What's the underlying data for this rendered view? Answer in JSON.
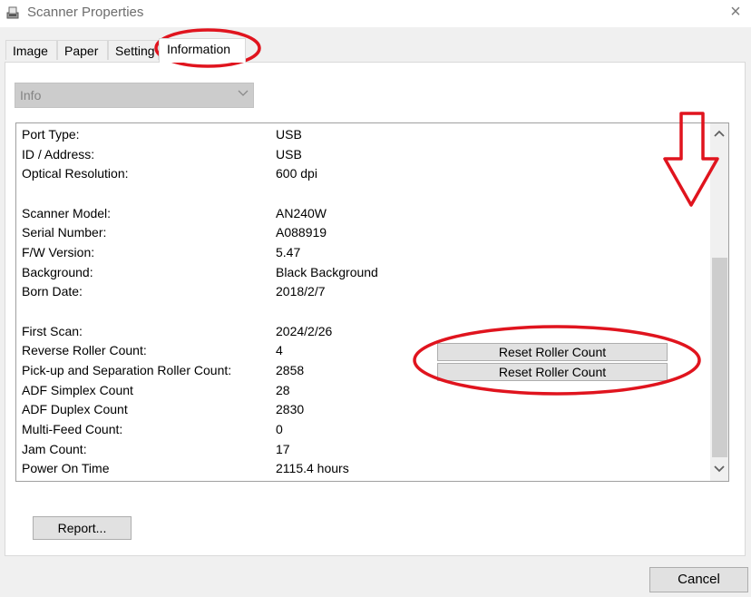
{
  "window": {
    "title": "Scanner Properties",
    "close_glyph": "×",
    "icon": "scanner-icon"
  },
  "tabs": [
    {
      "label": "Image",
      "active": false
    },
    {
      "label": "Paper",
      "active": false
    },
    {
      "label": "Setting",
      "active": false
    },
    {
      "label": "Information",
      "active": true
    }
  ],
  "info_select": {
    "value": "Info",
    "disabled": true
  },
  "info_rows": [
    {
      "label": "Port Type:",
      "value": "USB"
    },
    {
      "label": "ID / Address:",
      "value": "USB"
    },
    {
      "label": "Optical Resolution:",
      "value": "600 dpi"
    },
    {
      "label": "Scanner Model:",
      "value": "AN240W"
    },
    {
      "label": "Serial Number:",
      "value": "A088919"
    },
    {
      "label": "F/W Version:",
      "value": "5.47"
    },
    {
      "label": "Background:",
      "value": "Black Background"
    },
    {
      "label": "Born Date:",
      "value": "2018/2/7"
    },
    {
      "label": "First Scan:",
      "value": "2024/2/26"
    },
    {
      "label": "Reverse Roller Count:",
      "value": "4"
    },
    {
      "label": "Pick-up and Separation Roller Count:",
      "value": "2858"
    },
    {
      "label": "ADF Simplex Count",
      "value": "28"
    },
    {
      "label": "ADF Duplex Count",
      "value": "2830"
    },
    {
      "label": "Multi-Feed Count:",
      "value": "0"
    },
    {
      "label": "Jam Count:",
      "value": "17"
    },
    {
      "label": "Power On Time",
      "value": "2115.4 hours"
    }
  ],
  "reset_buttons": [
    {
      "label": "Reset Roller Count"
    },
    {
      "label": "Reset Roller Count"
    }
  ],
  "buttons": {
    "report": "Report...",
    "cancel": "Cancel"
  },
  "colors": {
    "annotation": "#e0141e",
    "button_face": "#e1e1e1",
    "disabled_combo": "#cccccc"
  }
}
